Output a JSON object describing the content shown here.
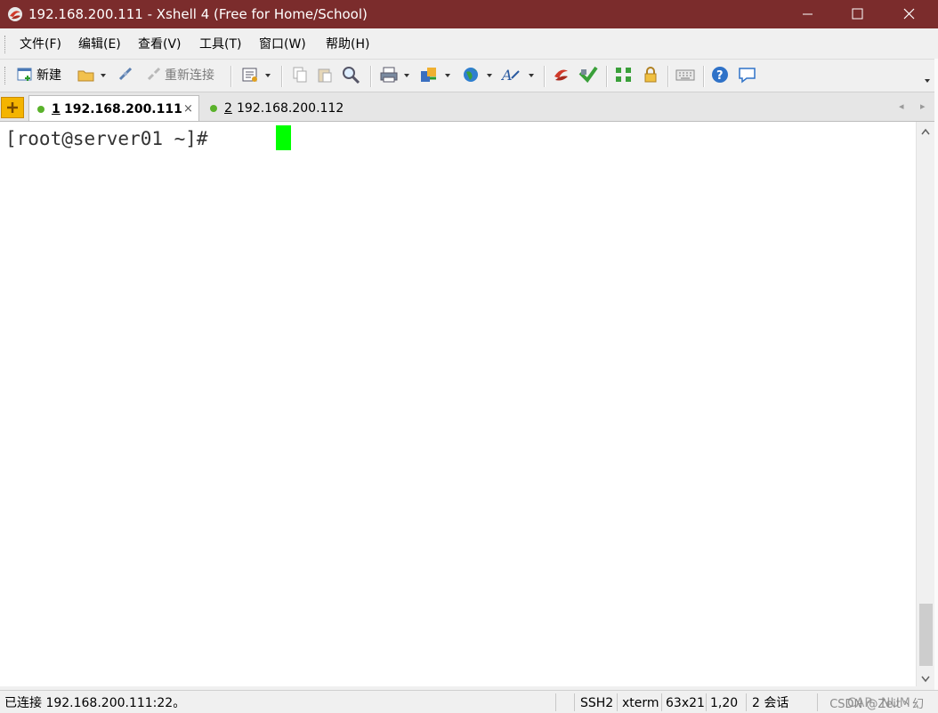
{
  "window": {
    "title": "192.168.200.111 - Xshell 4 (Free for Home/School)",
    "title_bar_color": "#7b2c2c"
  },
  "menu": {
    "items": [
      "文件(F)",
      "编辑(E)",
      "查看(V)",
      "工具(T)",
      "窗口(W)",
      "帮助(H)"
    ]
  },
  "toolbar": {
    "new_label": "新建",
    "reconnect_label": "重新连接",
    "icons": [
      "new-session-icon",
      "open-folder-icon",
      "disconnect-icon",
      "reconnect-icon",
      "properties-icon",
      "copy-icon",
      "paste-icon",
      "find-icon",
      "print-icon",
      "transfer-icon",
      "globe-icon",
      "font-icon",
      "xftp-icon",
      "xmanager-icon",
      "fullscreen-icon",
      "lock-icon",
      "keyboard-icon",
      "help-icon",
      "chat-icon"
    ]
  },
  "tabs": [
    {
      "num": "1",
      "host": "192.168.200.111",
      "active": true,
      "close": "×"
    },
    {
      "num": "2",
      "host": "192.168.200.112",
      "active": false
    }
  ],
  "terminal": {
    "prompt": "[root@server01 ~]# ",
    "cursor_color": "#00ff00"
  },
  "status": {
    "connection": "已连接 192.168.200.111:22。",
    "protocol": "SSH2",
    "term": "xterm",
    "size": "63x21",
    "position": "1,20",
    "sessions": "2 会话",
    "caps": "CAP",
    "num": "NUM",
    "watermark": "CSDN @Zeit丶幻"
  }
}
